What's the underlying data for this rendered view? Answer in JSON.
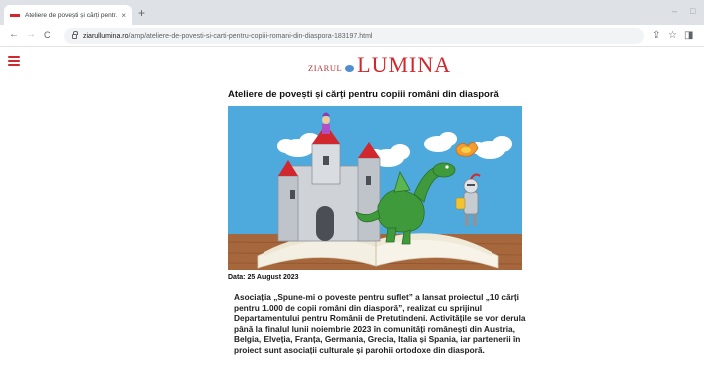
{
  "browser": {
    "tab_title": "Ateliere de povești și cărți pentr...",
    "tab_close": "×",
    "new_tab": "+",
    "url_host": "ziarullumina.ro",
    "url_path": "/amp/ateliere-de-povesti-si-carti-pentru-copiii-romani-din-diaspora-183197.html",
    "nav": {
      "back": "←",
      "forward": "→",
      "reload": "C"
    },
    "window_controls": {
      "minimize": "–",
      "maximize": "□"
    },
    "toolbar_icons": {
      "share": "⇪",
      "bookmark": "☆",
      "sidebar": "◨",
      "profile": "●"
    }
  },
  "site": {
    "logo_small": "ZIARUL",
    "logo_big": "LUMINA"
  },
  "article": {
    "title": "Ateliere de povești și cărți pentru copiii români din diasporă",
    "date": "Data: 25 August 2023",
    "body": "Asociația „Spune-mi o poveste pentru suflet” a lansat proiectul „10 cărți pentru 1.000 de copii români din diasporă”, realizat cu sprijinul Departamentului pentru Românii de Pretutindeni. Activitățile se vor derula până la finalul lunii noiembrie 2023 în comunități românești din Austria, Belgia, Elveția, Franța, Germania, Grecia, Italia și Spania, iar partenerii în proiect sunt asociații culturale și parohii ortodoxe din diasporă."
  },
  "colors": {
    "brand_red": "#d0282d",
    "sky": "#4ea9dc",
    "table": "#a7673c",
    "dragon": "#3e9a3a"
  }
}
